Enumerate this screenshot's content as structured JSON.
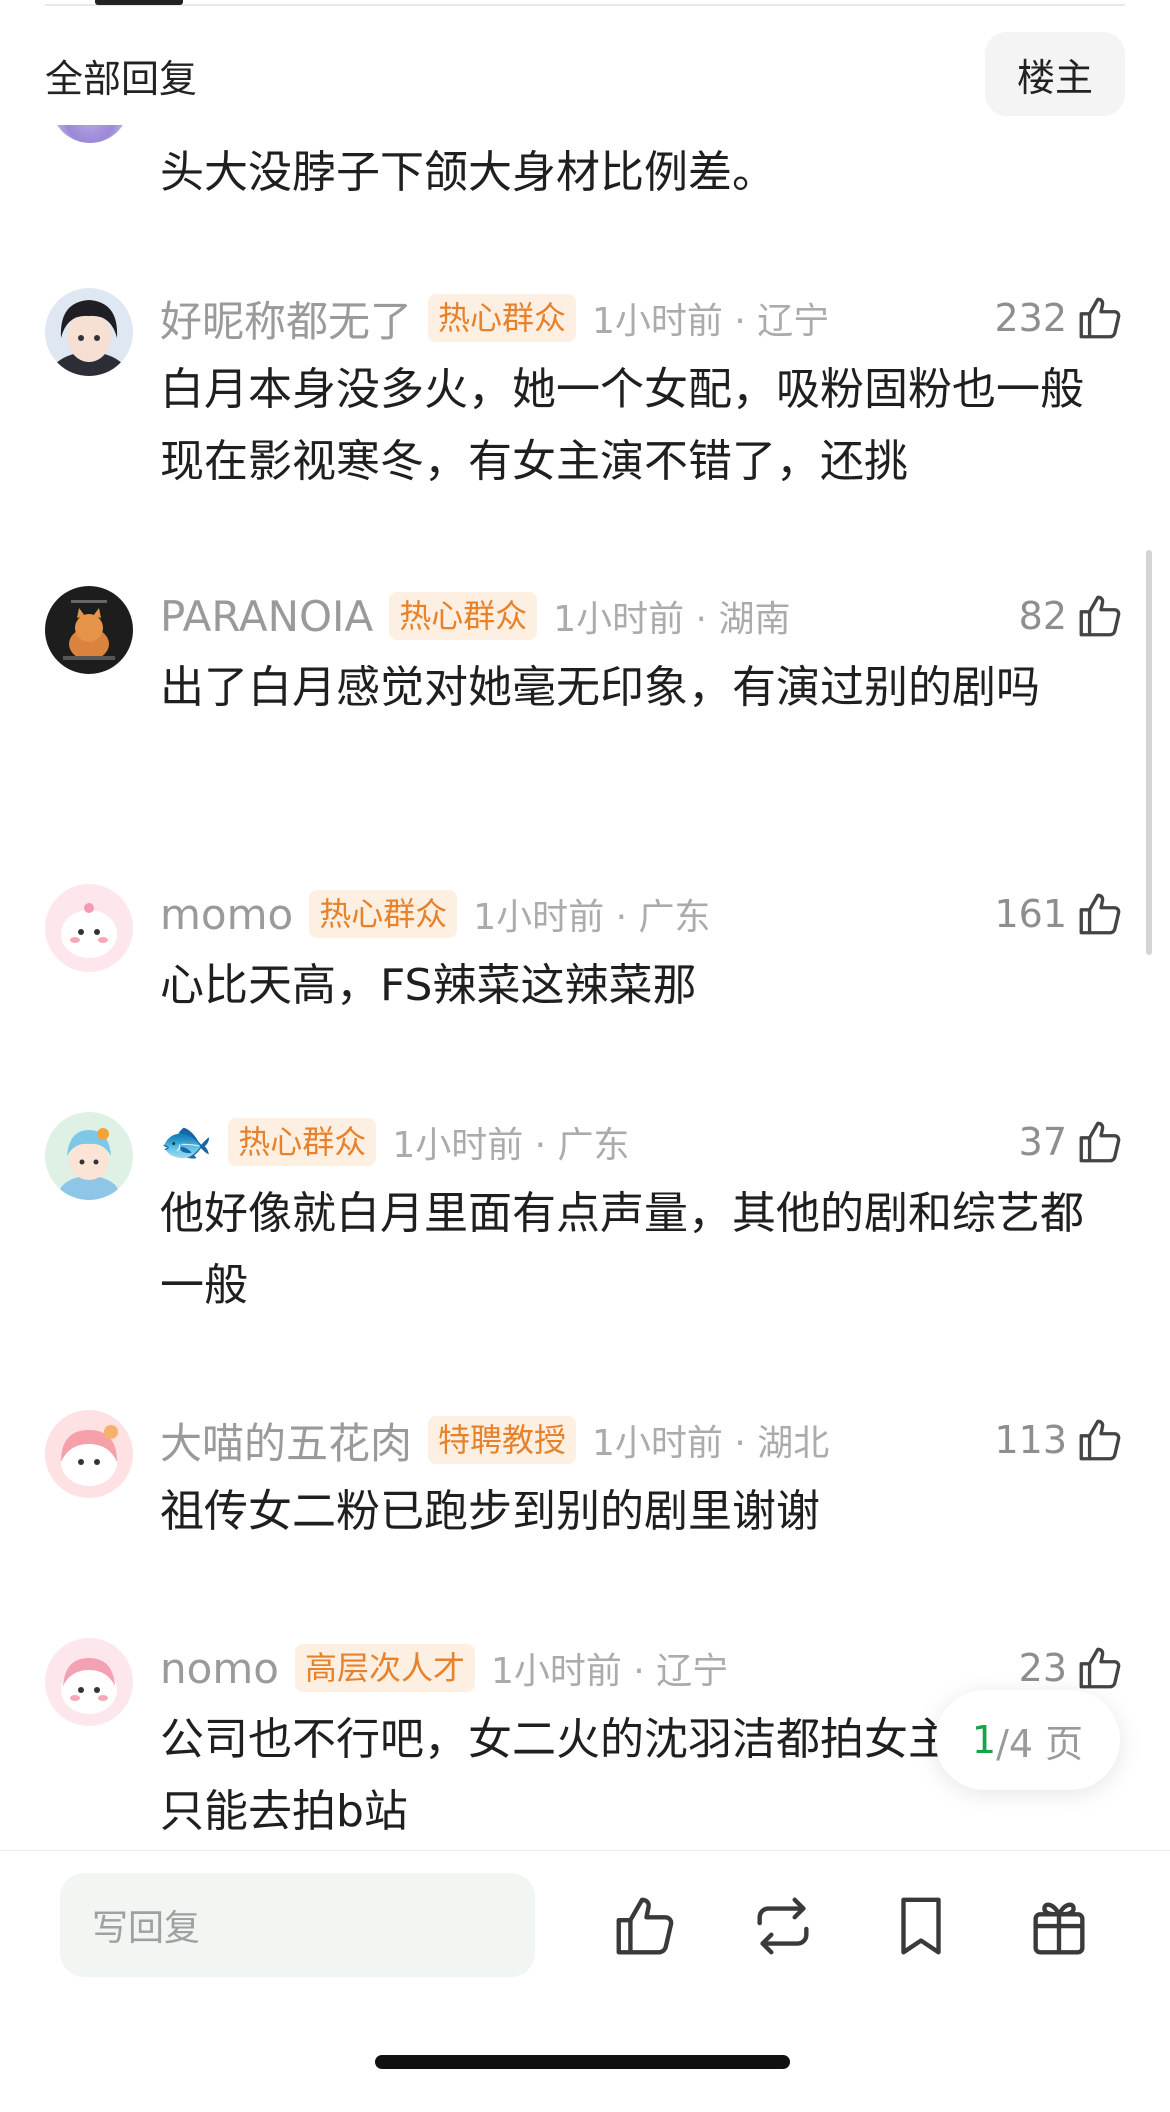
{
  "header": {
    "title": "全部回复",
    "louzhu_button": "楼主"
  },
  "partial_comment": {
    "text": "头大没脖子下颌大身材比例差。"
  },
  "comments": [
    {
      "username": "好昵称都无了",
      "badge": "热心群众",
      "time_location": "1小时前 · 辽宁",
      "likes": "232",
      "text": "白月本身没多火，她一个女配，吸粉固粉也一般 现在影视寒冬，有女主演不错了，还挑"
    },
    {
      "username": "PARANOIA",
      "badge": "热心群众",
      "time_location": "1小时前 · 湖南",
      "likes": "82",
      "text": "出了白月感觉对她毫无印象，有演过别的剧吗"
    },
    {
      "username": "momo",
      "badge": "热心群众",
      "time_location": "1小时前 · 广东",
      "likes": "161",
      "text": "心比天高，FS辣菜这辣菜那"
    },
    {
      "username": "🐟",
      "badge": "热心群众",
      "time_location": "1小时前 · 广东",
      "likes": "37",
      "text": "他好像就白月里面有点声量，其他的剧和综艺都一般"
    },
    {
      "username": "大喵的五花肉",
      "badge": "特聘教授",
      "time_location": "1小时前 · 湖北",
      "likes": "113",
      "text": "祖传女二粉已跑步到别的剧里谢谢"
    },
    {
      "username": "nomo",
      "badge": "高层次人才",
      "time_location": "1小时前 · 辽宁",
      "likes": "23",
      "text": "公司也不行吧，女二火的沈羽洁都拍女主了，她只能去拍b站"
    }
  ],
  "pagination": {
    "current": "1",
    "total": "/4 页"
  },
  "bottom_bar": {
    "reply_placeholder": "写回复"
  },
  "colors": {
    "badge_text": "#e7822b",
    "badge_bg": "#fdf0e3",
    "page_current": "#17a34a",
    "meta_gray": "#9a9a9a"
  }
}
